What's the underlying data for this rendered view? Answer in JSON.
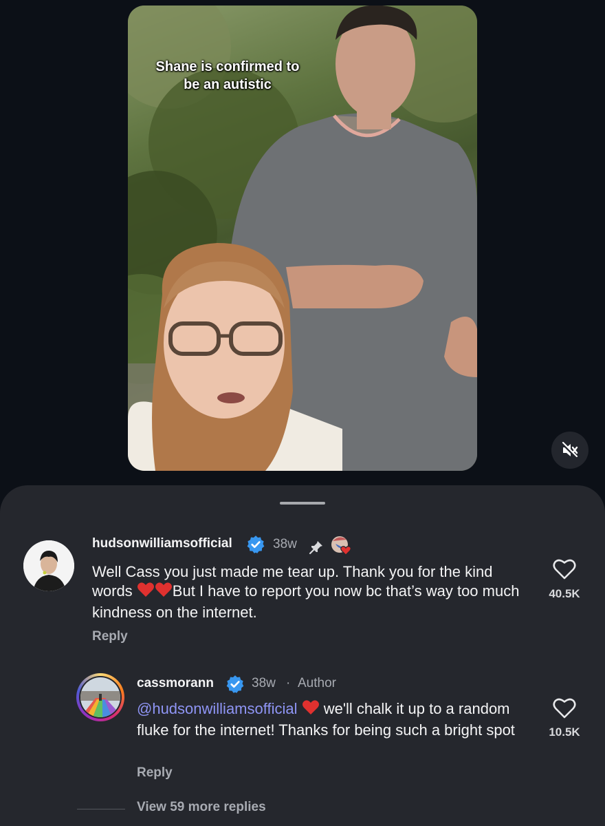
{
  "video": {
    "caption_line1": "Shane is confirmed to",
    "caption_line2": "be an autistic",
    "mute_icon": "speaker-muted-icon"
  },
  "comments": [
    {
      "username": "hudsonwilliamsofficial",
      "age": "38w",
      "pinned_icon": "pin-icon",
      "liked_by_creator_icon": "creator-heart-avatar-icon",
      "text_part1": "Well Cass you just made me tear up. Thank you for the kind words ",
      "text_part2": "But I have to report you now bc that’s way too much kindness on the internet.",
      "reply_label": "Reply",
      "like_count": "40.5K"
    },
    {
      "username": "cassmorann",
      "age": "38w",
      "author_label": "Author",
      "mention": "@hudsonwilliamsofficial",
      "text_part2": " we'll chalk it up to a random fluke for the internet! Thanks for being such a bright spot",
      "reply_label": "Reply",
      "like_count": "10.5K"
    }
  ],
  "view_more_replies": "View 59 more replies",
  "colors": {
    "background": "#0c1017",
    "sheet": "#25272d",
    "verified": "#3897f0",
    "mention": "#8f95f5",
    "heart_emoji": "#e0312f"
  }
}
